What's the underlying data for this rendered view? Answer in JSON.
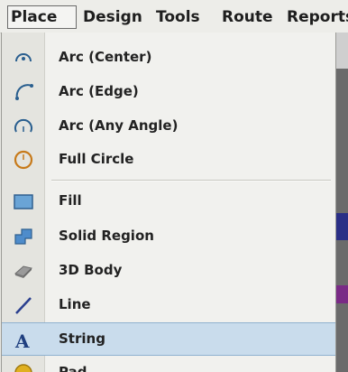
{
  "menubar": {
    "items": [
      {
        "label": "Place",
        "active": true
      },
      {
        "label": "Design"
      },
      {
        "label": "Tools"
      },
      {
        "label": "Route"
      },
      {
        "label": "Reports"
      }
    ]
  },
  "menu": {
    "items": [
      {
        "label": "Arc (Center)",
        "icon": "arc-center-icon"
      },
      {
        "label": "Arc (Edge)",
        "icon": "arc-edge-icon"
      },
      {
        "label": "Arc (Any Angle)",
        "icon": "arc-any-angle-icon"
      },
      {
        "label": "Full Circle",
        "icon": "full-circle-icon"
      },
      {
        "label": "Fill",
        "icon": "fill-icon"
      },
      {
        "label": "Solid Region",
        "icon": "solid-region-icon"
      },
      {
        "label": "3D Body",
        "icon": "3d-body-icon"
      },
      {
        "label": "Line",
        "icon": "line-icon"
      },
      {
        "label": "String",
        "icon": "string-icon",
        "highlighted": true
      },
      {
        "label": "Pad",
        "icon": "pad-icon"
      }
    ]
  },
  "colors": {
    "highlight": "#c9dcec",
    "arc_icon": "#2a5f8f",
    "circle_icon": "#c77a1a"
  }
}
